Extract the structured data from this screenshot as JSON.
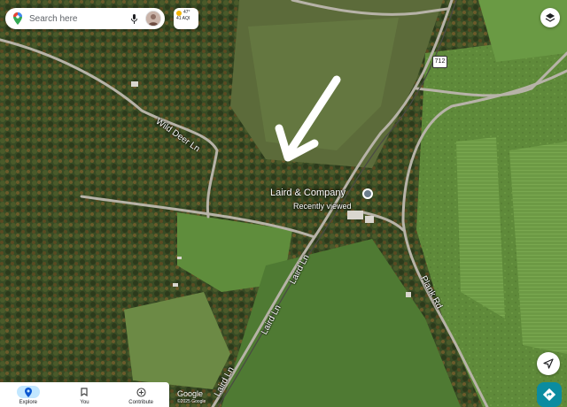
{
  "search": {
    "placeholder": "Search here"
  },
  "weather": {
    "temp": "47°",
    "aqi": "41 AQI"
  },
  "route_shield": "712",
  "roads": {
    "wild_deer": "Wild Deer Ln",
    "laird_1": "Laird Ln",
    "laird_2": "Laird Ln",
    "laird_3": "Laird Ln",
    "plank": "Plank Rd"
  },
  "place": {
    "name": "Laird & Company",
    "subtitle": "Recently viewed"
  },
  "bottom_nav": [
    {
      "label": "Explore",
      "icon": "location-pin-icon",
      "active": true
    },
    {
      "label": "You",
      "icon": "bookmark-icon",
      "active": false
    },
    {
      "label": "Contribute",
      "icon": "plus-circle-icon",
      "active": false
    }
  ],
  "attribution": {
    "logo": "Google",
    "copyright": "©2025 Google"
  },
  "colors": {
    "accent": "#1a73e8",
    "directions": "#0b8ca0",
    "active_tab": "#c2e7ff"
  }
}
